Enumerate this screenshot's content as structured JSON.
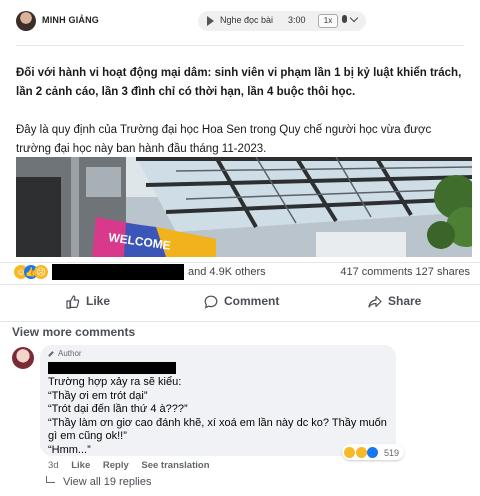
{
  "article": {
    "author": "MINH GIẢNG",
    "audio": {
      "label": "Nghe đọc bài",
      "duration": "3:00",
      "speed": "1x"
    },
    "lead_bold": "Đối với hành vi hoạt động mại dâm: sinh viên vi phạm lần 1 bị kỷ luật khiển trách, lần 2 cảnh cáo, lần 3 đình chỉ có thời hạn, lần 4 buộc thôi học.",
    "paragraph": "Đây là quy định của Trường đại học Hoa Sen trong Quy chế người học vừa được trường đại học này ban hành đầu tháng 11-2023.",
    "photo_sign_text": "WELCOME"
  },
  "reactions": {
    "others": "and 4.9K others",
    "counts": "417 comments   127 shares"
  },
  "actions": {
    "like": "Like",
    "comment": "Comment",
    "share": "Share"
  },
  "view_more": "View more comments",
  "comment": {
    "tag": "Author",
    "text": "Trường hợp xảy ra sẽ kiểu:\n“Thầy ơi em trót dại”\n“Trót dại đến lần thứ 4 à???”\n“Thầy làm ơn giơ cao đánh khẽ, xí xoá em lần này dc ko? Thầy muốn gì em cũng ok!!”\n“Hmm...”",
    "reaction_count": "519",
    "time": "3d",
    "like": "Like",
    "reply": "Reply",
    "translate": "See translation",
    "view_replies": "View all 19 replies"
  },
  "colors": {
    "accent": "#1877f2",
    "bubble": "#f0f2f5",
    "muted": "#65676b"
  }
}
